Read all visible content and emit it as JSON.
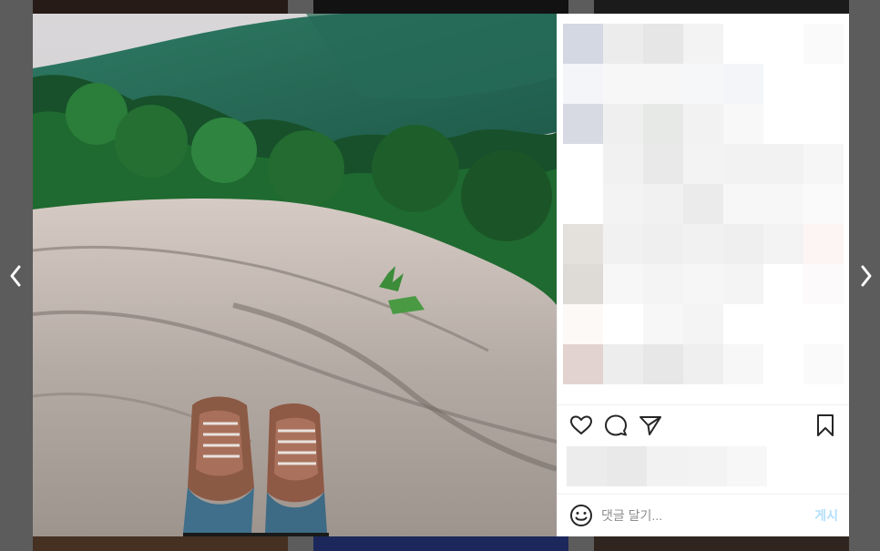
{
  "icons": {
    "prev": "chevron-left-icon",
    "next": "chevron-right-icon",
    "like": "heart-icon",
    "comment": "comment-icon",
    "share": "paper-plane-icon",
    "save": "bookmark-icon",
    "emoji": "smiley-icon"
  },
  "comment_box": {
    "placeholder": "댓글 달기...",
    "post_label": "게시"
  },
  "colors": {
    "backdrop": "#8e8e8e",
    "post_button": "#b2dffc",
    "divider": "#efefef"
  }
}
